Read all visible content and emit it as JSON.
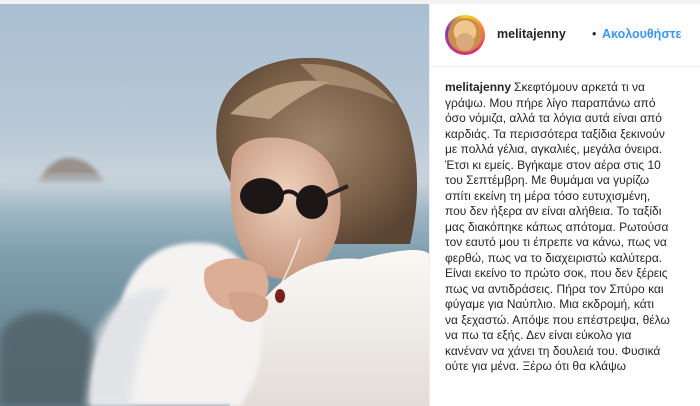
{
  "post": {
    "username": "melitajenny",
    "separator": "•",
    "follow_label": "Ακολουθήστε",
    "caption_username": "melitajenny",
    "caption_lines": [
      "Σκεφτόμουν αρκετά τι να",
      "γράψω. Μου πήρε λίγο παραπάνω από",
      "όσο νόμιζα, αλλά τα λόγια αυτά είναι από",
      "καρδιάς. Τα περισσότερα ταξίδια ξεκινούν",
      "με πολλά γέλια, αγκαλιές, μεγάλα όνειρα.",
      "Έτσι κι εμείς. Βγήκαμε στον αέρα στις 10",
      "του Σεπτέμβρη. Με θυμάμαι να γυρίζω",
      "σπίτι εκείνη τη μέρα τόσο ευτυχισμένη,",
      "που δεν ήξερα αν είναι αλήθεια. Το ταξίδι",
      "μας διακόπηκε κάπως απότομα. Ρωτούσα",
      "τον εαυτό μου τι έπρεπε να κάνω, πως να",
      "φερθώ, πως να το διαχειριστώ καλύτερα.",
      "Είναι εκείνο το πρώτο σοκ, που δεν ξέρεις",
      "πως να αντιδράσεις. Πήρα τον Σπύρο και",
      "φύγαμε για Ναύπλιο. Μια εκδρομή, κάτι",
      "να ξεχαστώ. Απόψε που επέστρεψα, θέλω",
      "να πω τα εξής. Δεν είναι εύκολο για",
      "κανέναν να χάνει τη δουλειά του. Φυσικά",
      "ούτε για μένα. Ξέρω ότι θα κλάψω"
    ]
  },
  "icons": {
    "avatar": "profile-avatar-with-story-ring"
  },
  "colors": {
    "follow": "#3897f0",
    "text": "#262626"
  }
}
